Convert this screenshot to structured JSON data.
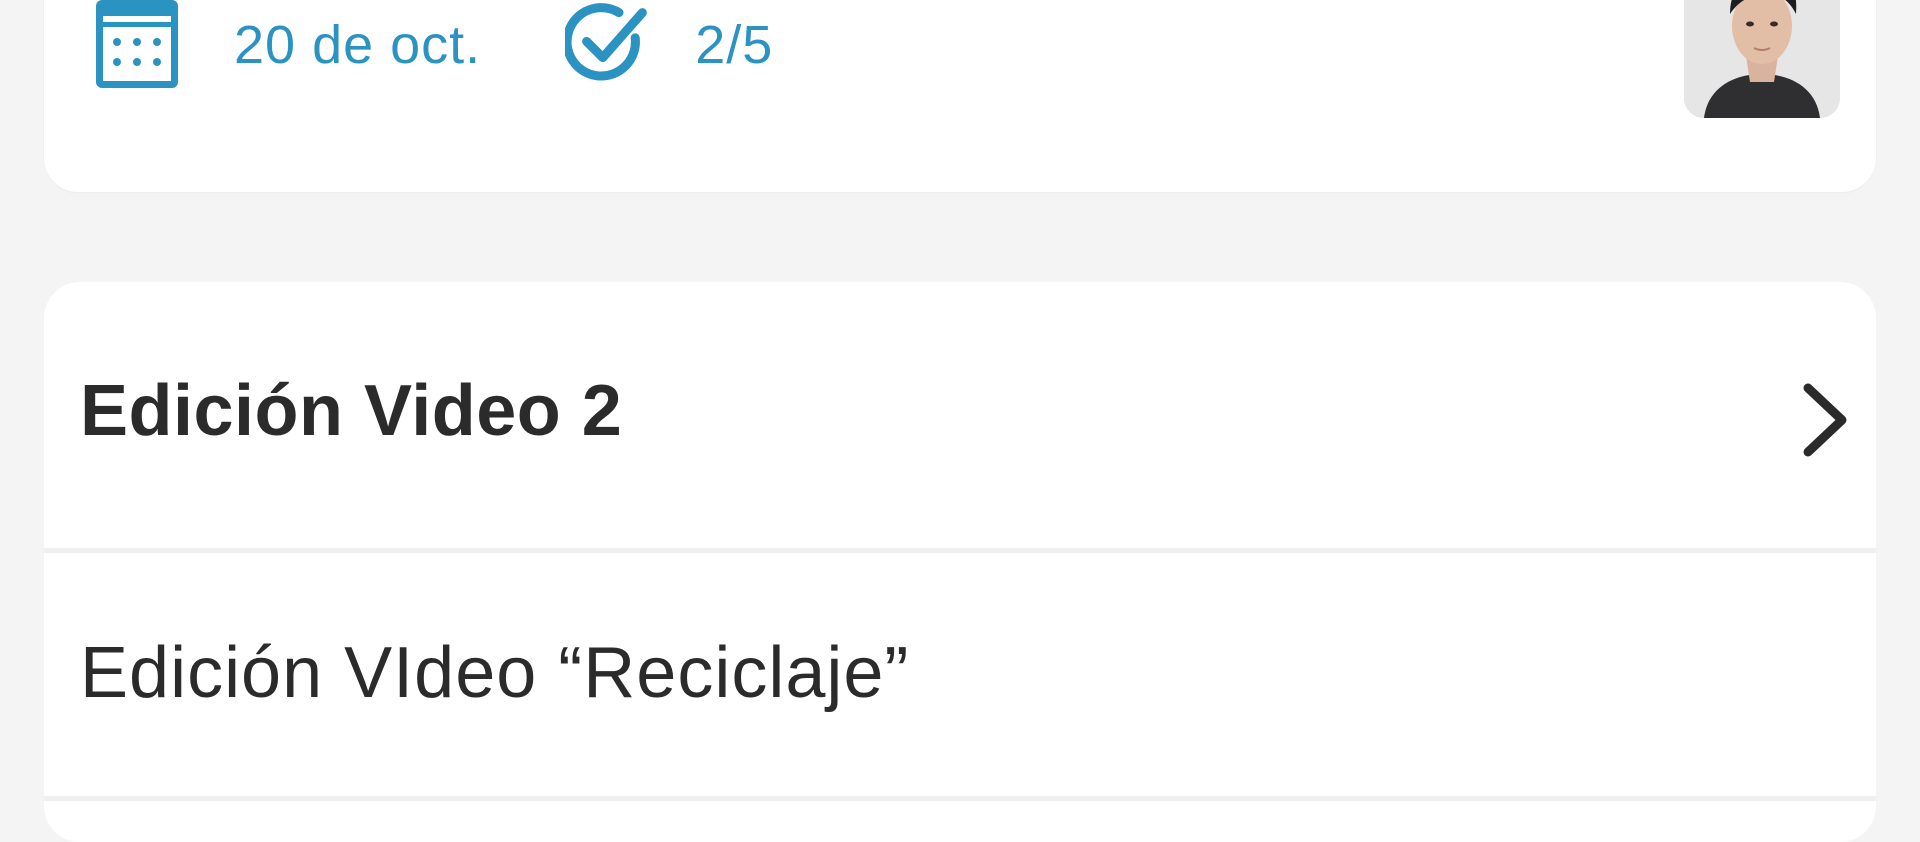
{
  "project_card": {
    "due_date": "20 de oct.",
    "progress": "2/5",
    "icons": {
      "date": "calendar-icon",
      "progress": "check-circle-icon"
    },
    "accent_color": "#2b93c1"
  },
  "task_group": {
    "title": "Edición Video 2",
    "items": [
      {
        "label": "Edición VIdeo “Reciclaje”"
      }
    ],
    "chevron_icon": "chevron-right-icon"
  },
  "colors": {
    "background": "#f4f4f4",
    "card": "#ffffff",
    "text": "#2b2b2b",
    "accent": "#2b93c1"
  }
}
